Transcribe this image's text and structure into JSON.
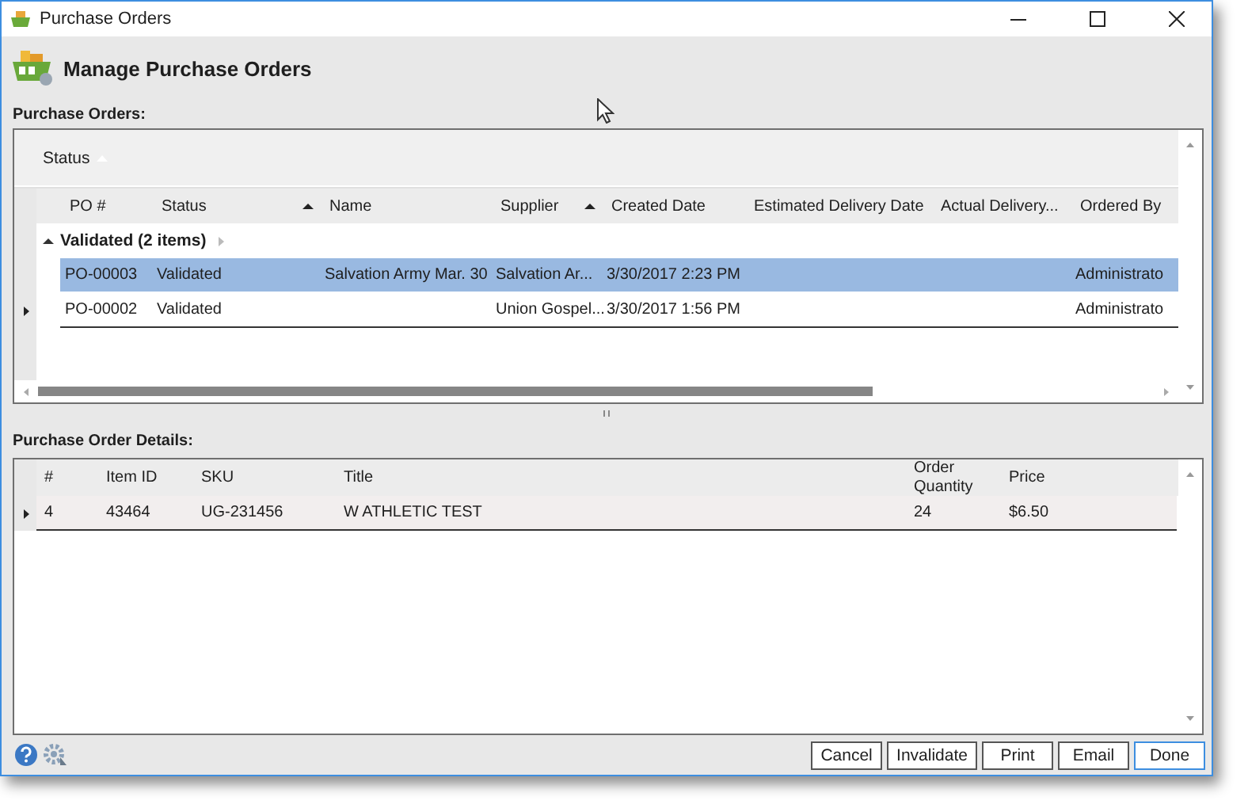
{
  "window": {
    "title": "Purchase Orders"
  },
  "header": {
    "title": "Manage Purchase Orders"
  },
  "purchase_orders": {
    "label": "Purchase Orders:",
    "group_panel": {
      "label": "Status"
    },
    "columns": [
      {
        "label": "PO #",
        "sorted": false
      },
      {
        "label": "Status",
        "sorted": true
      },
      {
        "label": "Name",
        "sorted": false
      },
      {
        "label": "Supplier",
        "sorted": true
      },
      {
        "label": "Created Date",
        "sorted": false
      },
      {
        "label": "Estimated Delivery Date",
        "sorted": false
      },
      {
        "label": "Actual Delivery...",
        "sorted": false
      },
      {
        "label": "Ordered By",
        "sorted": false
      }
    ],
    "groups": [
      {
        "label": "Validated (2 items)",
        "expanded": true,
        "rows": [
          {
            "selected": true,
            "current": false,
            "cells": [
              "PO-00003",
              "Validated",
              "Salvation Army Mar. 30",
              "Salvation Ar...",
              "3/30/2017 2:23 PM",
              null,
              null,
              "Administrato"
            ]
          },
          {
            "selected": false,
            "current": true,
            "cells": [
              "PO-00002",
              "Validated",
              null,
              "Union Gospel...",
              "3/30/2017 1:56 PM",
              null,
              null,
              "Administrato"
            ]
          }
        ]
      }
    ]
  },
  "details": {
    "label": "Purchase Order Details:",
    "columns": [
      "#",
      "Item ID",
      "SKU",
      "Title",
      "Order Quantity",
      "Price"
    ],
    "rows": [
      {
        "current": true,
        "cells": [
          "4",
          "43464",
          "UG-231456",
          "W ATHLETIC TEST",
          "24",
          "$6.50"
        ]
      }
    ]
  },
  "buttons": [
    {
      "label": "Cancel",
      "default": false
    },
    {
      "label": "Invalidate",
      "default": false
    },
    {
      "label": "Print",
      "default": false
    },
    {
      "label": "Email",
      "default": false
    },
    {
      "label": "Done",
      "default": true
    }
  ]
}
